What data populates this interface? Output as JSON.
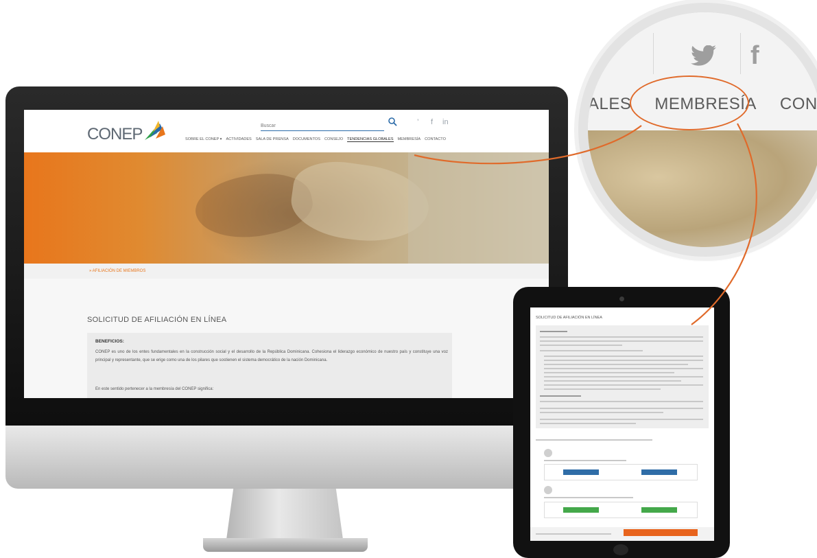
{
  "site": {
    "logo": "CONEP",
    "search_placeholder": "Buscar",
    "social": {
      "twitter": "’",
      "facebook": "f",
      "linkedin": "in"
    },
    "nav": [
      "SOBRE EL CONEP ▾",
      "ACTIVIDADES",
      "SALA DE PRENSA",
      "DOCUMENTOS",
      "CONSEJO",
      "TENDENCIAS GLOBALES",
      "MEMBRESÍA",
      "CONTACTO"
    ],
    "breadcrumb": "» AFILIACIÓN DE MIEMBROS",
    "page_title": "SOLICITUD DE AFILIACIÓN EN LÍNEA",
    "benefits_heading": "BENEFICIOS:",
    "benefits_text": "CONEP es uno de los entes fundamentales en la construcción social y el desarrollo de la República Dominicana. Cohesiona el liderazgo económico de nuestro país y constituye una voz principal y representante, que se erige como una de los pilares que sostienen el sistema democrático de la nación Dominicana.",
    "benefits_extra": "En este sentido pertenecer a la membresía del CONEP significa:"
  },
  "magnifier": {
    "nav_items": [
      "ALES",
      "MEMBRESÍA",
      "CONTA"
    ],
    "facebook": "f"
  },
  "tablet": {
    "title": "SOLICITUD DE AFILIACIÓN EN LÍNEA"
  },
  "colors": {
    "accent": "#e06a2a",
    "brand_blue": "#2a6aa8",
    "hero_orange": "#e8761c"
  }
}
